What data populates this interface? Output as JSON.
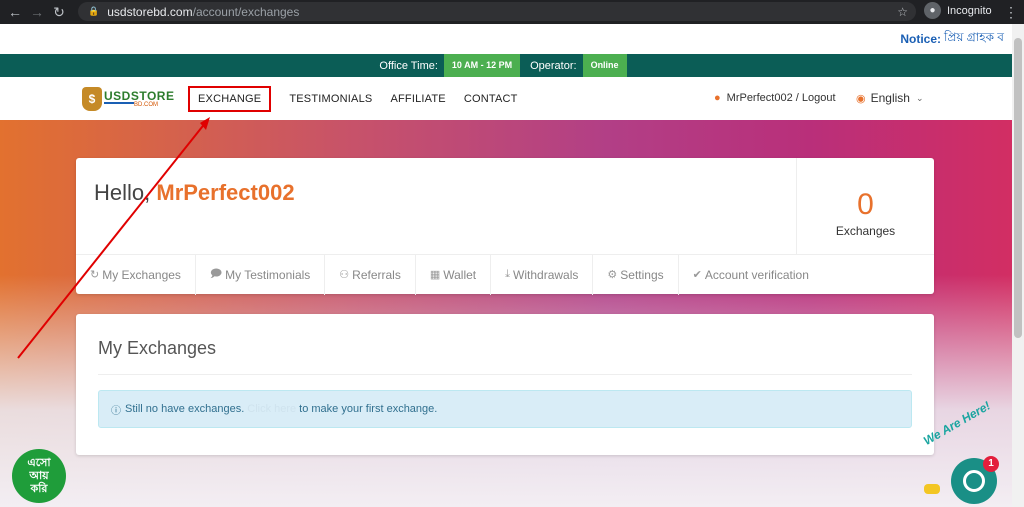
{
  "browser": {
    "url_host": "usdstorebd.com",
    "url_path": "/account/exchanges",
    "profile": "Incognito"
  },
  "notice": {
    "label": "Notice:",
    "text": "প্রিয় গ্রাহক ব"
  },
  "office": {
    "time_label": "Office Time:",
    "time_value": "10 AM - 12 PM",
    "operator_label": "Operator:",
    "operator_status": "Online"
  },
  "header": {
    "logo_text": "USDSTORE",
    "logo_tld": "BD.COM",
    "nav": [
      "EXCHANGE",
      "TESTIMONIALS",
      "AFFILIATE",
      "CONTACT"
    ],
    "user_text": "MrPerfect002 / Logout",
    "language": "English"
  },
  "profile": {
    "greeting": "Hello,",
    "username": "MrPerfect002",
    "exchange_count": "0",
    "exchange_label": "Exchanges",
    "tabs": [
      "My Exchanges",
      "My Testimonials",
      "Referrals",
      "Wallet",
      "Withdrawals",
      "Settings",
      "Account verification"
    ]
  },
  "exchanges": {
    "title": "My Exchanges",
    "alert_prefix": "Still no have exchanges.",
    "alert_link": "Click here",
    "alert_suffix": "to make your first exchange."
  },
  "widgets": {
    "badge_line1": "এসো",
    "badge_line2": "আয়",
    "badge_line3": "করি",
    "chat_tagline": "We Are Here!",
    "chat_unread": "1"
  },
  "colors": {
    "accent": "#e8712c",
    "office_bar": "#0b5d56",
    "pill_green": "#4caf50",
    "annotation_red": "#e00000"
  }
}
